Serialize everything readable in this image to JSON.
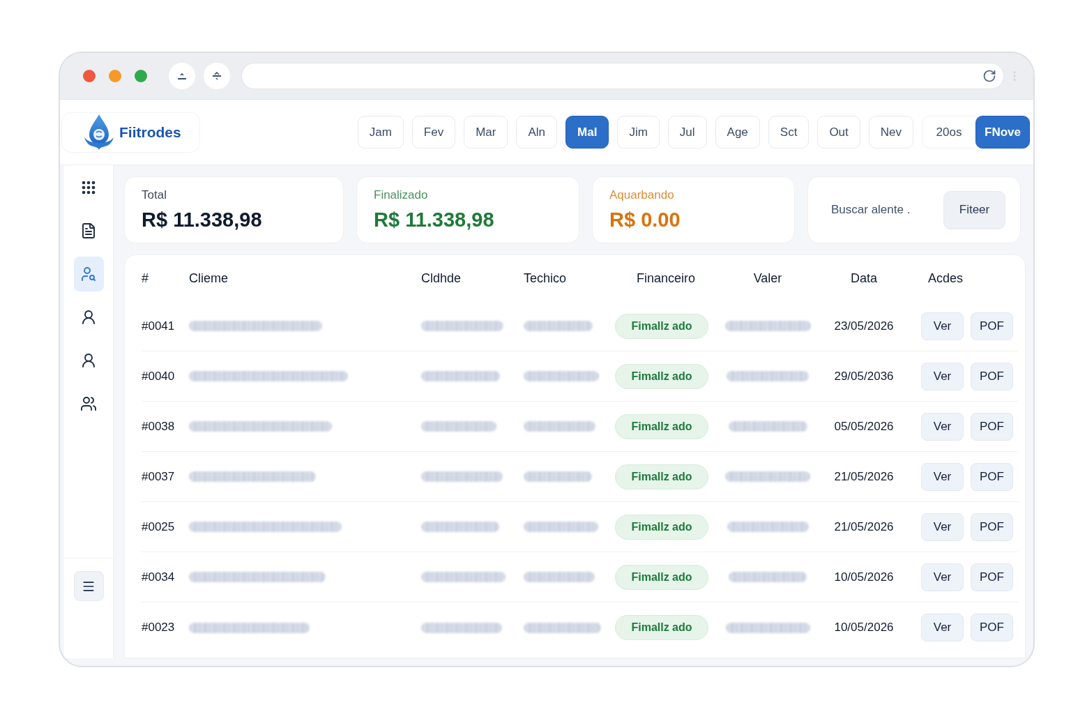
{
  "brand": {
    "name": "Fiitrodes"
  },
  "months": [
    {
      "label": "Jam",
      "selected": false
    },
    {
      "label": "Fev",
      "selected": false
    },
    {
      "label": "Mar",
      "selected": false
    },
    {
      "label": "Aln",
      "selected": false
    },
    {
      "label": "Mal",
      "selected": true
    },
    {
      "label": "Jim",
      "selected": false
    },
    {
      "label": "Jul",
      "selected": false
    },
    {
      "label": "Age",
      "selected": false
    },
    {
      "label": "Sct",
      "selected": false
    },
    {
      "label": "Out",
      "selected": false
    },
    {
      "label": "Nev",
      "selected": false
    }
  ],
  "year": "20os",
  "new_button": "FNove",
  "sidebar": {
    "items": [
      {
        "selected": false
      },
      {
        "selected": false
      },
      {
        "selected": true
      },
      {
        "selected": false
      },
      {
        "selected": false
      },
      {
        "selected": false
      }
    ]
  },
  "summary_cards": [
    {
      "label": "Total",
      "value": "R$ 11.338,98",
      "color": "#111b2e"
    },
    {
      "label": "Finalizado",
      "value": "R$ 11.338,98",
      "color": "#1f7a3a"
    },
    {
      "label": "Aquarbando",
      "value": "R$ 0.00",
      "color": "#d9730d"
    }
  ],
  "search": {
    "placeholder": "Buscar alente .",
    "button": "Fiteer"
  },
  "table": {
    "columns": [
      {
        "label": "#",
        "kind": "id"
      },
      {
        "label": "Clieme",
        "kind": "redacted"
      },
      {
        "label": "Cldhde",
        "kind": "redacted"
      },
      {
        "label": "Techico",
        "kind": "redacted"
      },
      {
        "label": "Financeiro",
        "kind": "status"
      },
      {
        "label": "Valer",
        "kind": "redacted"
      },
      {
        "label": "Data",
        "kind": "date"
      },
      {
        "label": "Acdes",
        "kind": "actions"
      }
    ],
    "rows": [
      {
        "id": "#0041",
        "status": "Fimallz ado",
        "date": "23/05/2026",
        "actions": [
          "Ver",
          "POF"
        ]
      },
      {
        "id": "#0040",
        "status": "Fimallz ado",
        "date": "29/05/2036",
        "actions": [
          "Ver",
          "POF"
        ]
      },
      {
        "id": "#0038",
        "status": "Fimallz ado",
        "date": "05/05/2026",
        "actions": [
          "Ver",
          "POF"
        ]
      },
      {
        "id": "#0037",
        "status": "Fimallz ado",
        "date": "21/05/2026",
        "actions": [
          "Ver",
          "POF"
        ]
      },
      {
        "id": "#0025",
        "status": "Fimallz ado",
        "date": "21/05/2026",
        "actions": [
          "Ver",
          "POF"
        ]
      },
      {
        "id": "#0034",
        "status": "Fimallz ado",
        "date": "10/05/2026",
        "actions": [
          "Ver",
          "POF"
        ]
      },
      {
        "id": "#0023",
        "status": "Fimallz ado",
        "date": "10/05/2026",
        "actions": [
          "Ver",
          "POF"
        ]
      }
    ]
  }
}
